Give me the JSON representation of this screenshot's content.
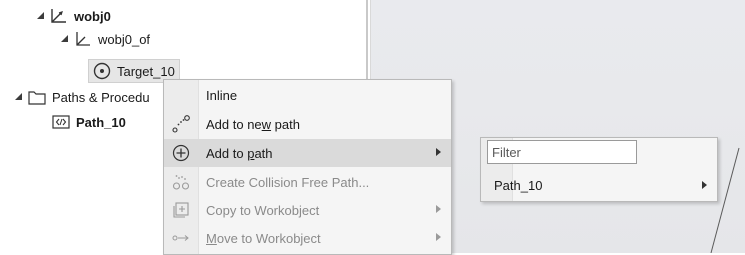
{
  "tree": {
    "items": [
      {
        "label": "wobj0",
        "icon": "workobject-icon",
        "bold": true
      },
      {
        "label": "wobj0_of",
        "icon": "frame-icon",
        "bold": false
      },
      {
        "label": "Target_10",
        "icon": "target-icon",
        "bold": false,
        "selected": true
      },
      {
        "label": "Paths & Procedu",
        "icon": "folder-icon",
        "bold": false
      },
      {
        "label": "Path_10",
        "icon": "path-icon",
        "bold": true
      }
    ]
  },
  "context_menu": {
    "items": [
      {
        "label": "Inline",
        "icon": "",
        "enabled": true,
        "submenu": false
      },
      {
        "label": "Add to new path",
        "mnemonic_prefix": "Add to ne",
        "mnemonic_char": "w",
        "mnemonic_suffix": " path",
        "icon": "new-path-icon",
        "enabled": true,
        "submenu": false
      },
      {
        "label": "Add to path",
        "mnemonic_prefix": "Add to ",
        "mnemonic_char": "p",
        "mnemonic_suffix": "ath",
        "icon": "add-circle-icon",
        "enabled": true,
        "submenu": true,
        "highlighted": true
      },
      {
        "label": "Create Collision Free Path...",
        "icon": "collision-free-path-icon",
        "enabled": false,
        "submenu": false
      },
      {
        "label": "Copy to Workobject",
        "icon": "copy-workobject-icon",
        "enabled": false,
        "submenu": true
      },
      {
        "label": "Move to Workobject",
        "mnemonic_prefix": "",
        "mnemonic_char": "M",
        "mnemonic_suffix": "ove to Workobject",
        "icon": "move-workobject-icon",
        "enabled": false,
        "submenu": true
      }
    ]
  },
  "submenu": {
    "filter_placeholder": "Filter",
    "items": [
      {
        "label": "Path_10",
        "submenu": true
      }
    ]
  }
}
